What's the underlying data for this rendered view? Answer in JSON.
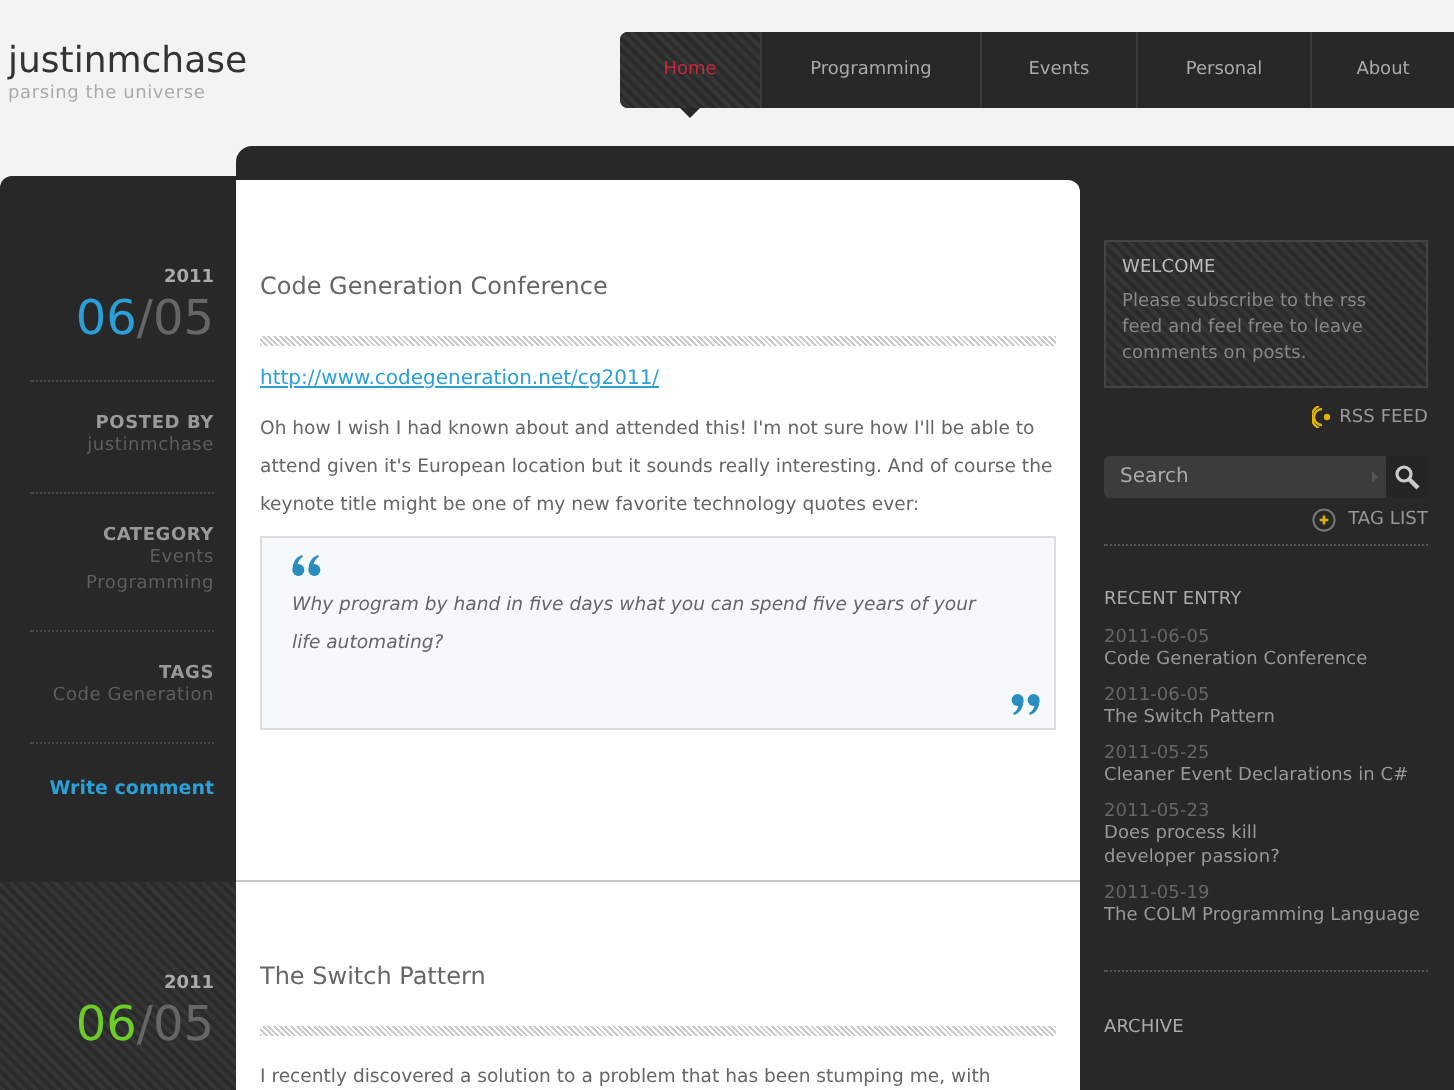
{
  "site": {
    "title": "justinmchase",
    "tagline": "parsing the universe"
  },
  "nav": [
    {
      "label": "Home",
      "selected": true
    },
    {
      "label": "Programming",
      "selected": false
    },
    {
      "label": "Events",
      "selected": false
    },
    {
      "label": "Personal",
      "selected": false
    },
    {
      "label": "About",
      "selected": false
    }
  ],
  "posts": [
    {
      "year": "2011",
      "month": "06",
      "separator": "/",
      "day": "05",
      "color": "#2a9fd8",
      "posted_by_label": "POSTED BY",
      "author": "justinmchase",
      "category_label": "CATEGORY",
      "categories": [
        "Events",
        "Programming"
      ],
      "tags_label": "TAGS",
      "tags": [
        "Code Generation"
      ],
      "comment_link": "Write comment",
      "title": "Code Generation Conference",
      "link": "http://www.codegeneration.net/cg2011/",
      "body": "Oh how I wish I had known about and attended this! I'm not sure how I'll be able to attend given it's European location but it sounds really interesting. And of course the keynote title might be one of my new favorite technology quotes ever:",
      "quote": "Why program by hand in five days what you can spend five years of your life automating?"
    },
    {
      "year": "2011",
      "month": "06",
      "separator": "/",
      "day": "05",
      "color": "#6ccc2a",
      "title": "The Switch Pattern",
      "body": "I recently discovered a solution to a problem that has been stumping me, with"
    }
  ],
  "sidebar": {
    "welcome": {
      "title": "WELCOME",
      "text": "Please subscribe to the rss feed and feel free to leave comments on posts."
    },
    "rss_label": "RSS FEED",
    "search": {
      "placeholder": "Search"
    },
    "tag_list_label": "TAG LIST",
    "recent_title": "RECENT ENTRY",
    "recent": [
      {
        "date": "2011-06-05",
        "title": "Code Generation Conference"
      },
      {
        "date": "2011-06-05",
        "title": "The Switch Pattern"
      },
      {
        "date": "2011-05-25",
        "title": "Cleaner Event Declarations in C#"
      },
      {
        "date": "2011-05-23",
        "title": "Does process kill developer passion?"
      },
      {
        "date": "2011-05-19",
        "title": "The COLM Programming Language"
      }
    ],
    "archive_title": "ARCHIVE"
  }
}
